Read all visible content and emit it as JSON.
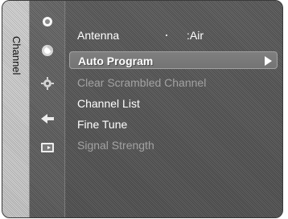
{
  "sidebar": {
    "tab_label": "Channel"
  },
  "icons": [
    {
      "name": "picture-icon"
    },
    {
      "name": "channel-icon"
    },
    {
      "name": "setup-icon"
    },
    {
      "name": "input-icon"
    },
    {
      "name": "application-icon"
    }
  ],
  "menu": {
    "antenna_label": "Antenna",
    "antenna_value": ":Air",
    "auto_program_label": "Auto Program",
    "clear_scrambled_channel_label": "Clear Scrambled Channel",
    "channel_list_label": "Channel List",
    "fine_tune_label": "Fine Tune",
    "signal_strength_label": "Signal Strength"
  },
  "colors": {
    "text": "#ffffff",
    "disabled_text": "#a2a2a2",
    "highlight": "#7f7f7f"
  }
}
